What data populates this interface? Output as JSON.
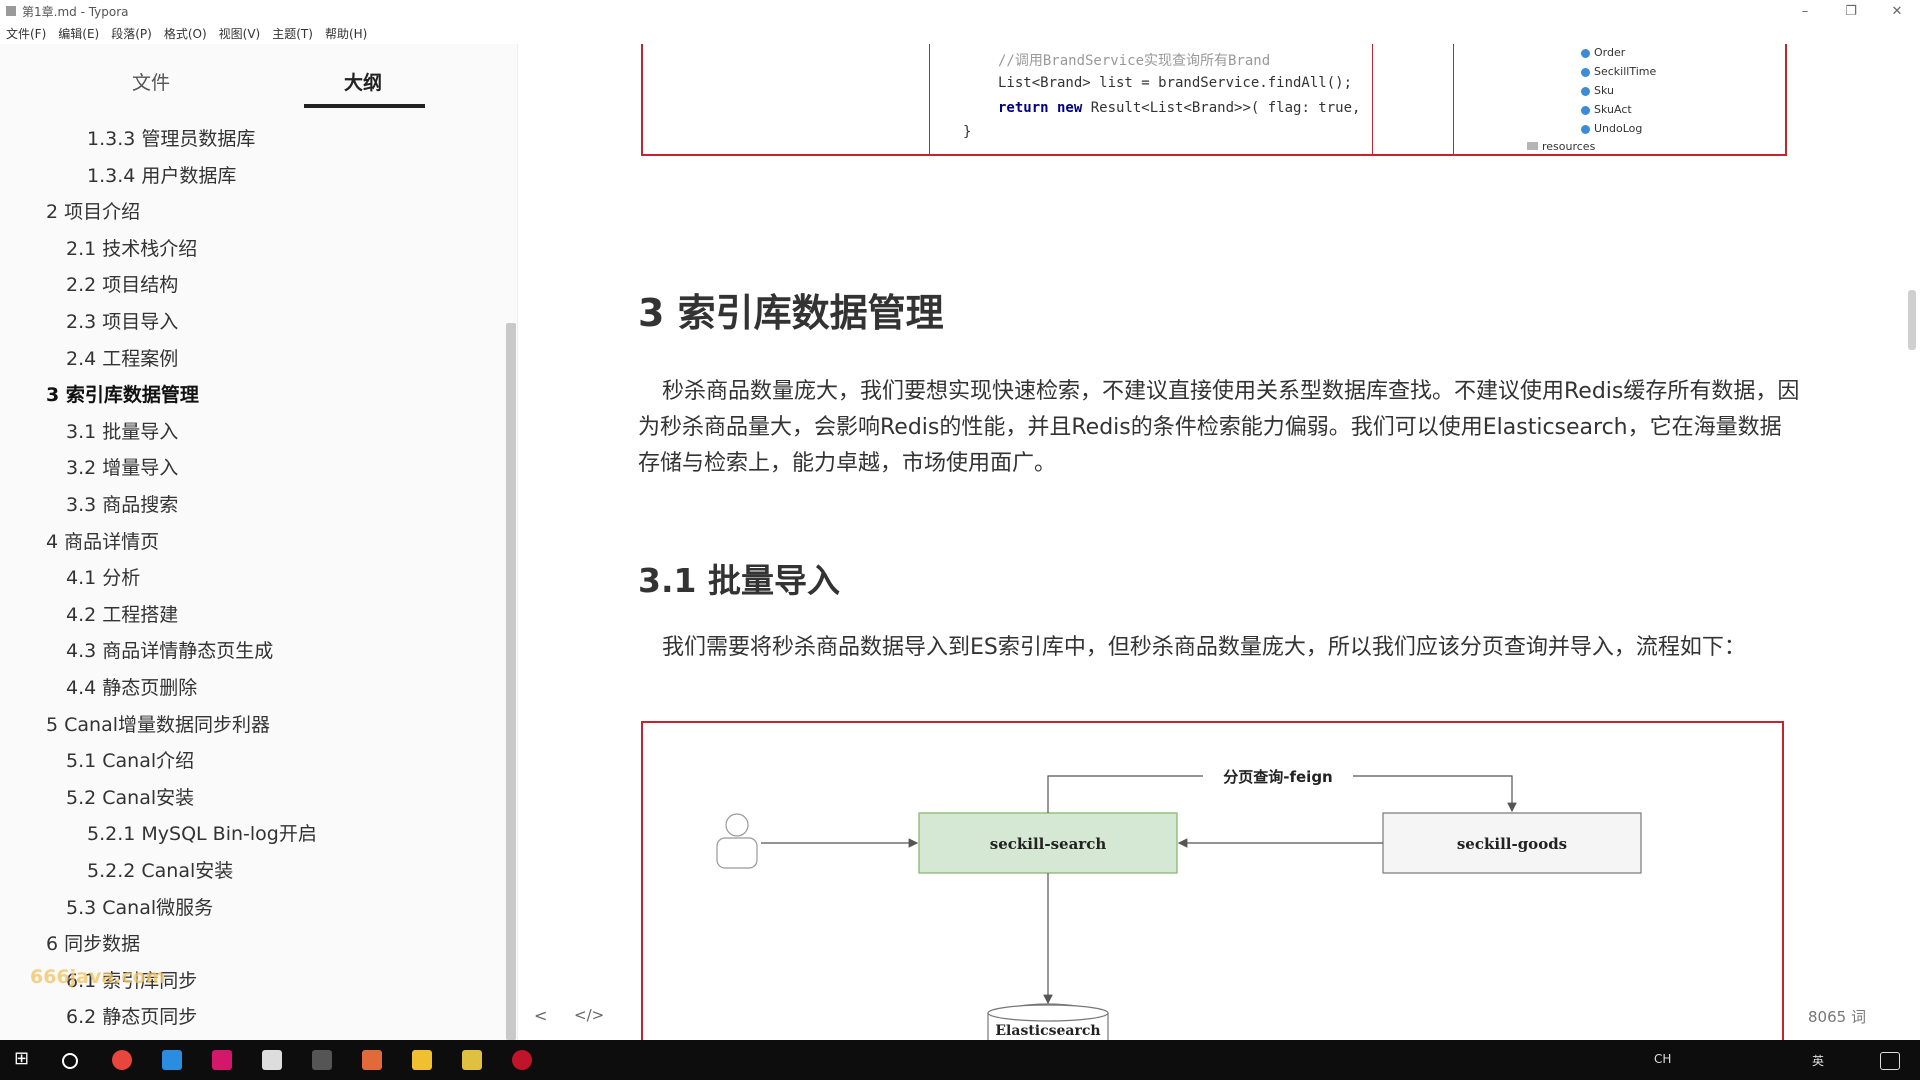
{
  "window": {
    "title": "第1章.md - Typora",
    "controls": [
      "–",
      "❐",
      "✕"
    ]
  },
  "menu": [
    "文件(F)",
    "编辑(E)",
    "段落(P)",
    "格式(O)",
    "视图(V)",
    "主题(T)",
    "帮助(H)"
  ],
  "sidebar": {
    "tabs": [
      "文件",
      "大纲"
    ],
    "active_tab": "大纲",
    "outline": [
      {
        "label": "1.3.3 管理员数据库",
        "level": 3
      },
      {
        "label": "1.3.4 用户数据库",
        "level": 3
      },
      {
        "label": "2 项目介绍",
        "level": 1
      },
      {
        "label": "2.1 技术栈介绍",
        "level": 2
      },
      {
        "label": "2.2 项目结构",
        "level": 2
      },
      {
        "label": "2.3 项目导入",
        "level": 2
      },
      {
        "label": "2.4 工程案例",
        "level": 2
      },
      {
        "label": "3 索引库数据管理",
        "level": 1,
        "active": true
      },
      {
        "label": "3.1 批量导入",
        "level": 2
      },
      {
        "label": "3.2 增量导入",
        "level": 2
      },
      {
        "label": "3.3 商品搜索",
        "level": 2
      },
      {
        "label": "4 商品详情页",
        "level": 1
      },
      {
        "label": "4.1 分析",
        "level": 2
      },
      {
        "label": "4.2 工程搭建",
        "level": 2
      },
      {
        "label": "4.3 商品详情静态页生成",
        "level": 2
      },
      {
        "label": "4.4 静态页删除",
        "level": 2
      },
      {
        "label": "5 Canal增量数据同步利器",
        "level": 1
      },
      {
        "label": "5.1 Canal介绍",
        "level": 2
      },
      {
        "label": "5.2 Canal安装",
        "level": 2
      },
      {
        "label": "5.2.1 MySQL Bin-log开启",
        "level": 3
      },
      {
        "label": "5.2.2 Canal安装",
        "level": 3
      },
      {
        "label": "5.3 Canal微服务",
        "level": 2
      },
      {
        "label": "6 同步数据",
        "level": 1
      },
      {
        "label": "6.1 索引库同步",
        "level": 2
      },
      {
        "label": "6.2 静态页同步",
        "level": 2
      }
    ],
    "watermark": "666java.com"
  },
  "code_snippet": {
    "comment": "//调用BrandService实现查询所有Brand",
    "line1": "List<Brand> list = brandService.findAll();",
    "line2_kw": "return new",
    "line2_rest": " Result<List<Brand>>( flag: true,",
    "line3": "}"
  },
  "project_tree": [
    "Order",
    "SeckillTime",
    "Sku",
    "SkuAct",
    "UndoLog",
    "resources"
  ],
  "content": {
    "h1": "3 索引库数据管理",
    "para1": "秒杀商品数量庞大，我们要想实现快速检索，不建议直接使用关系型数据库查找。不建议使用Redis缓存所有数据，因为秒杀商品量大，会影响Redis的性能，并且Redis的条件检索能力偏弱。我们可以使用Elasticsearch，它在海量数据存储与检索上，能力卓越，市场使用面广。",
    "h2": "3.1 批量导入",
    "para2": "我们需要将秒杀商品数据导入到ES索引库中，但秒杀商品数量庞大，所以我们应该分页查询并导入，流程如下："
  },
  "diagram": {
    "arrow_label": "分页查询-feign",
    "node_search": "seckill-search",
    "node_goods": "seckill-goods",
    "node_es": "Elasticsearch",
    "search_fill": "#d5e8d4",
    "search_stroke": "#82b366"
  },
  "footer": {
    "prev": "<",
    "code": "</>",
    "word_count": "8065 词"
  },
  "taskbar": {
    "tray": [
      "CH",
      "英"
    ]
  }
}
